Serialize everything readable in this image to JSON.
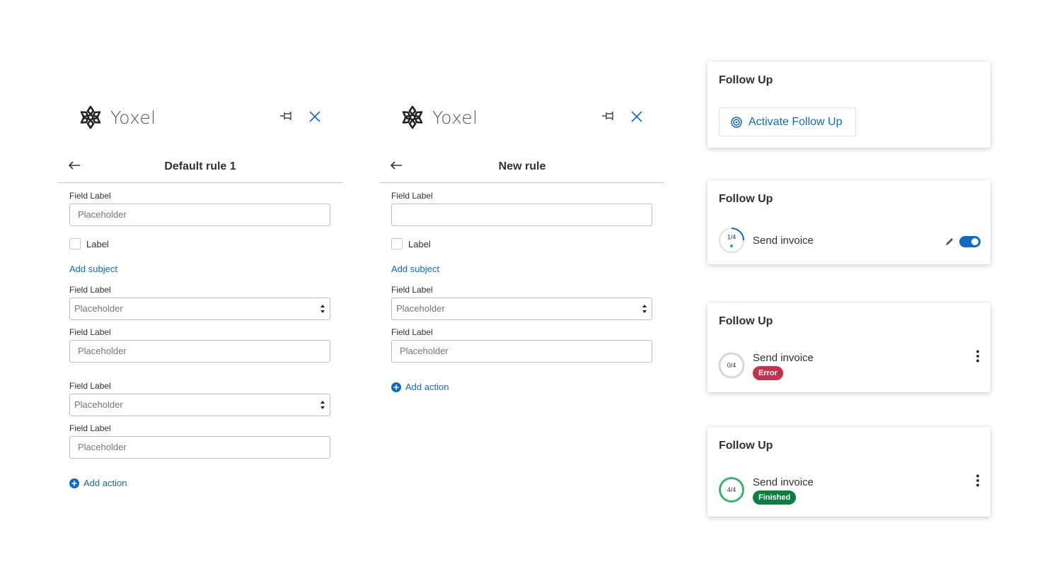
{
  "panels": [
    {
      "brand": "Yoxel",
      "title": "Default rule 1",
      "field_label_1": "Field Label",
      "input_1_placeholder": "Placeholder",
      "checkbox_label": "Label",
      "add_subject": "Add subject",
      "field_label_2": "Field Label",
      "select_1_value": "Placeholder",
      "field_label_3": "Field Label",
      "input_2_placeholder": "Placeholder",
      "field_label_4": "Field Label",
      "select_2_value": "Placeholder",
      "field_label_5": "Field Label",
      "input_3_placeholder": "Placeholder",
      "add_action": "Add action"
    },
    {
      "brand": "Yoxel",
      "title": "New rule",
      "field_label_1": "Field Label",
      "input_1_placeholder": "",
      "checkbox_label": "Label",
      "add_subject": "Add subject",
      "field_label_2": "Field Label",
      "select_1_value": "Placeholder",
      "field_label_3": "Field Label",
      "input_2_placeholder": "Placeholder",
      "add_action": "Add action"
    }
  ],
  "cards": [
    {
      "title": "Follow Up",
      "button": "Activate Follow Up"
    },
    {
      "title": "Follow Up",
      "item": "Send invoice",
      "progress": "1/4",
      "progress_fraction": 0.25,
      "toggle_on": true
    },
    {
      "title": "Follow Up",
      "item": "Send invoice",
      "progress": "0/4",
      "progress_fraction": 0,
      "status": "Error"
    },
    {
      "title": "Follow Up",
      "item": "Send invoice",
      "progress": "4/4",
      "progress_fraction": 1,
      "status": "Finished"
    }
  ],
  "colors": {
    "accent": "#0f6cbd",
    "error": "#c4314b",
    "finished": "#107c41",
    "progress_done": "#3cb371"
  }
}
